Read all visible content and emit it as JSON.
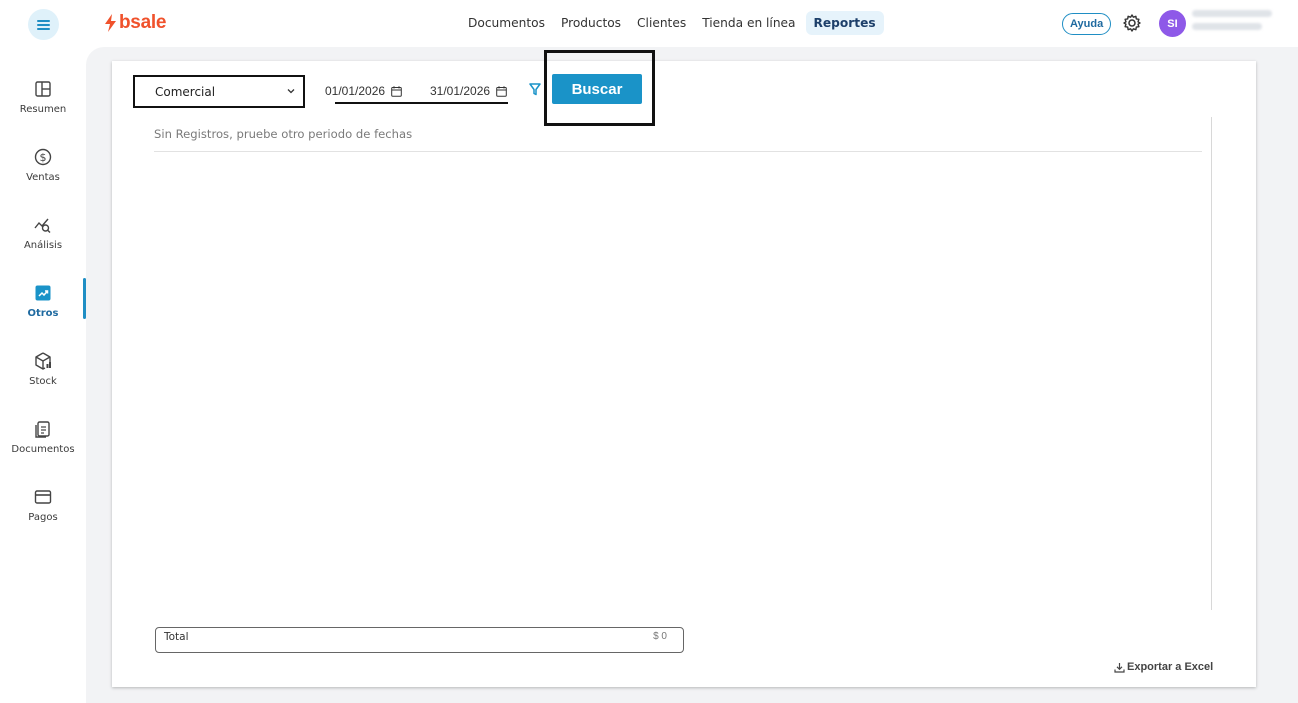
{
  "topbar": {
    "logo_text": "bsale",
    "nav": [
      {
        "label": "Documentos"
      },
      {
        "label": "Productos"
      },
      {
        "label": "Clientes"
      },
      {
        "label": "Tienda en línea"
      },
      {
        "label": "Reportes",
        "active": true
      }
    ],
    "help_label": "Ayuda",
    "avatar_initials": "SI"
  },
  "sidebar": {
    "items": [
      {
        "label": "Resumen",
        "icon": "dashboard-icon"
      },
      {
        "label": "Ventas",
        "icon": "dollar-circle-icon"
      },
      {
        "label": "Análisis",
        "icon": "chart-search-icon"
      },
      {
        "label": "Otros",
        "icon": "trend-box-icon",
        "active": true
      },
      {
        "label": "Stock",
        "icon": "box-icon"
      },
      {
        "label": "Documentos",
        "icon": "document-icon"
      },
      {
        "label": "Pagos",
        "icon": "card-icon"
      }
    ]
  },
  "filters": {
    "report_type": "Comercial",
    "date_from": "01/01/2026",
    "date_to": "31/01/2026",
    "search_label": "Buscar"
  },
  "results": {
    "empty_message": "Sin Registros, pruebe otro periodo de fechas"
  },
  "footer": {
    "total_label": "Total",
    "total_value": "$ 0",
    "export_label": "Exportar a Excel"
  },
  "colors": {
    "accent": "#1a93c8",
    "brand": "#f0522c",
    "avatar": "#8e59e8"
  }
}
